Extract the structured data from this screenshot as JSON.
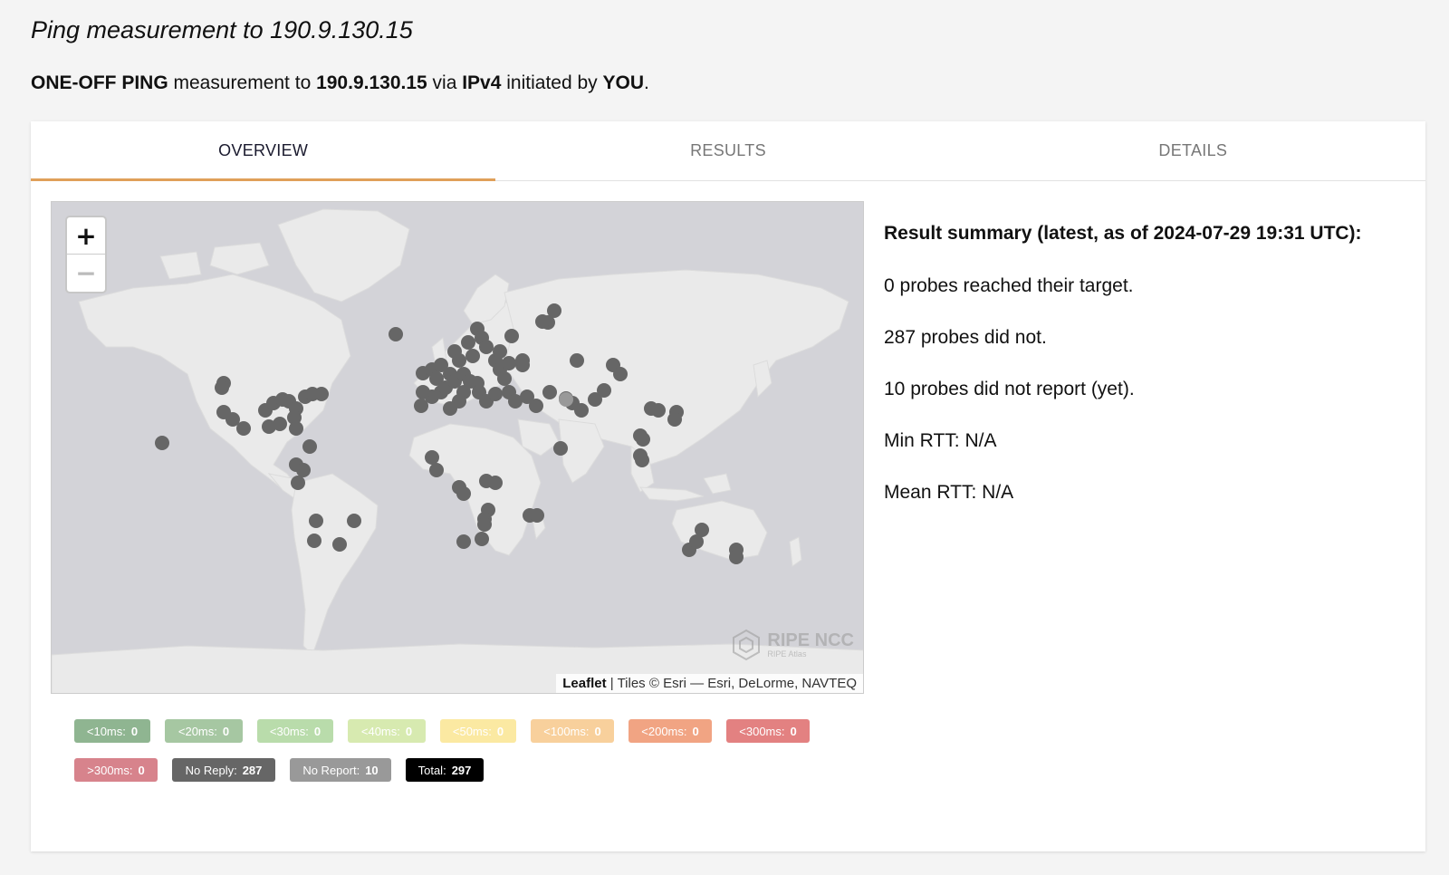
{
  "page": {
    "title": "Ping measurement to 190.9.130.15",
    "subtitle": {
      "type": "ONE-OFF PING",
      "text1": " measurement to ",
      "target": "190.9.130.15",
      "text2": " via ",
      "protocol": "IPv4",
      "text3": " initiated by ",
      "initiator": "YOU",
      "text4": "."
    }
  },
  "tabs": [
    {
      "label": "OVERVIEW",
      "active": true
    },
    {
      "label": "RESULTS",
      "active": false
    },
    {
      "label": "DETAILS",
      "active": false
    }
  ],
  "map": {
    "zoom_in": "+",
    "zoom_out": "−",
    "attribution_leaflet": "Leaflet",
    "attribution_rest": " | Tiles © Esri — Esri, DeLorme, NAVTEQ",
    "logo_name": "RIPE NCC",
    "logo_sub": "RIPE Atlas",
    "probe_color": "#666666",
    "no_report_color": "#999999"
  },
  "summary": {
    "heading": "Result summary (latest, as of 2024-07-29 19:31 UTC):",
    "reached": "0 probes reached their target.",
    "not_reached": "287 probes did not.",
    "not_reported": "10 probes did not report (yet).",
    "min_rtt": "Min RTT: N/A",
    "mean_rtt": "Mean RTT: N/A"
  },
  "legend": [
    {
      "label": "<10ms:",
      "count": "0",
      "color": "#8fb591"
    },
    {
      "label": "<20ms:",
      "count": "0",
      "color": "#a6c7a2"
    },
    {
      "label": "<30ms:",
      "count": "0",
      "color": "#b9dcab"
    },
    {
      "label": "<40ms:",
      "count": "0",
      "color": "#d7eab0"
    },
    {
      "label": "<50ms:",
      "count": "0",
      "color": "#fbe9a2"
    },
    {
      "label": "<100ms:",
      "count": "0",
      "color": "#f8d09c"
    },
    {
      "label": "<200ms:",
      "count": "0",
      "color": "#f1a483"
    },
    {
      "label": "<300ms:",
      "count": "0",
      "color": "#e38181"
    },
    {
      "label": ">300ms:",
      "count": "0",
      "color": "#d7838c"
    },
    {
      "label": "No Reply:",
      "count": "287",
      "color": "#666666"
    },
    {
      "label": "No Report:",
      "count": "10",
      "color": "#999999"
    },
    {
      "label": "Total:",
      "count": "297",
      "color": "#000000"
    }
  ]
}
